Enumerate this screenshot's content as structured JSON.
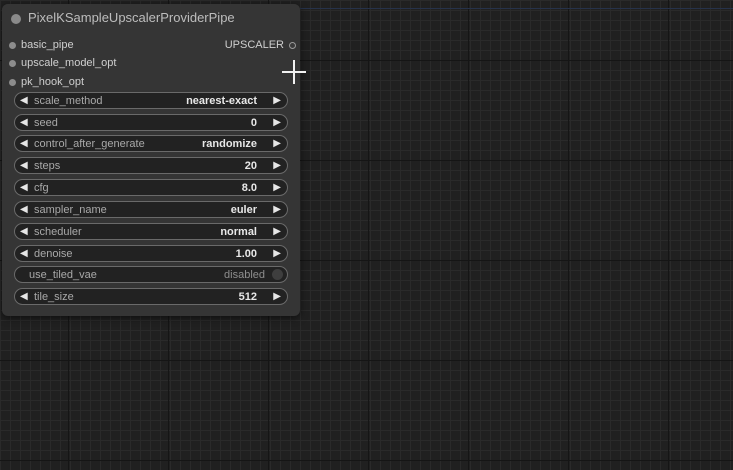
{
  "node": {
    "title": "PixelKSampleUpscalerProviderPipe",
    "inputs": [
      {
        "label": "basic_pipe"
      },
      {
        "label": "upscale_model_opt"
      },
      {
        "label": "pk_hook_opt"
      }
    ],
    "outputs": [
      {
        "label": "UPSCALER"
      }
    ],
    "widgets": [
      {
        "label": "scale_method",
        "value": "nearest-exact"
      },
      {
        "label": "seed",
        "value": "0"
      },
      {
        "label": "control_after_generate",
        "value": "randomize"
      },
      {
        "label": "steps",
        "value": "20"
      },
      {
        "label": "cfg",
        "value": "8.0"
      },
      {
        "label": "sampler_name",
        "value": "euler"
      },
      {
        "label": "scheduler",
        "value": "normal"
      },
      {
        "label": "denoise",
        "value": "1.00"
      },
      {
        "label": "use_tiled_vae",
        "value": "disabled"
      },
      {
        "label": "tile_size",
        "value": "512"
      }
    ]
  },
  "icons": {
    "left_arrow": "◀",
    "right_arrow": "▶"
  },
  "colors": {
    "canvas_bg": "#202020",
    "node_bg": "#353535",
    "widget_bg": "#222222"
  }
}
